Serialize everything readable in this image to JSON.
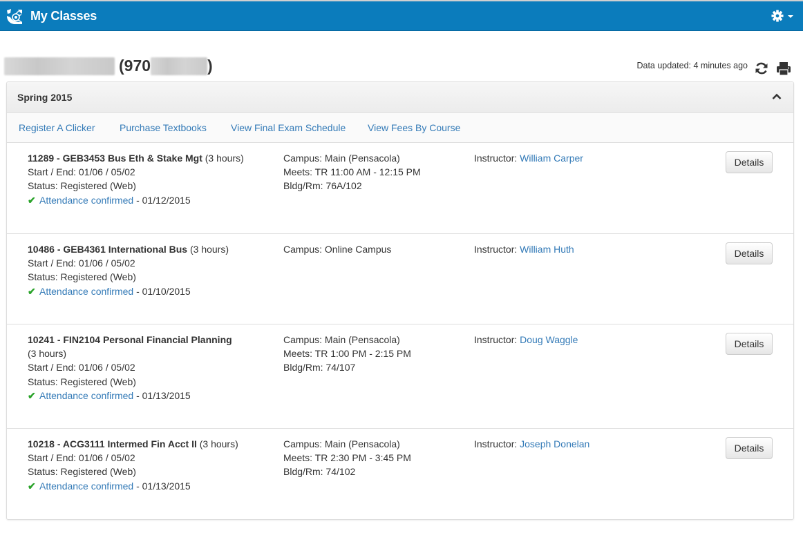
{
  "app": {
    "title": "My Classes",
    "logo_icon": "university-logo-icon",
    "settings_icon": "gear-icon"
  },
  "header": {
    "student_id_prefix": "(970",
    "student_id_suffix": ")",
    "data_updated": "Data updated: 4 minutes ago",
    "refresh_icon": "refresh-icon",
    "print_icon": "print-icon"
  },
  "term": {
    "title": "Spring 2015",
    "collapse_icon": "chevron-up-icon",
    "links": [
      {
        "label": "Register A Clicker"
      },
      {
        "label": "Purchase Textbooks"
      },
      {
        "label": "View Final Exam Schedule"
      },
      {
        "label": "View Fees By Course"
      }
    ]
  },
  "courses": [
    {
      "title": "11289 - GEB3453 Bus Eth & Stake Mgt",
      "hours": "(3 hours)",
      "start_end": "Start / End: 01/06 / 05/02",
      "status": "Status: Registered (Web)",
      "attendance_label": "Attendance confirmed",
      "attendance_date": " - 01/12/2015",
      "campus": "Campus: Main (Pensacola)",
      "meets": "Meets: TR 11:00 AM - 12:15 PM",
      "room": "Bldg/Rm: 76A/102",
      "instructor_label": "Instructor: ",
      "instructor": "William Carper",
      "details_label": "Details"
    },
    {
      "title": "10486 - GEB4361 International Bus",
      "hours": "(3 hours)",
      "start_end": "Start / End: 01/06 / 05/02",
      "status": "Status: Registered (Web)",
      "attendance_label": "Attendance confirmed",
      "attendance_date": " - 01/10/2015",
      "campus": "Campus: Online Campus",
      "meets": "",
      "room": "",
      "instructor_label": "Instructor: ",
      "instructor": "William Huth",
      "details_label": "Details"
    },
    {
      "title": "10241 - FIN2104 Personal Financial Planning",
      "hours": "(3 hours)",
      "start_end": "Start / End: 01/06 / 05/02",
      "status": "Status: Registered (Web)",
      "attendance_label": "Attendance confirmed",
      "attendance_date": " - 01/13/2015",
      "campus": "Campus: Main (Pensacola)",
      "meets": "Meets: TR 1:00 PM - 2:15 PM",
      "room": "Bldg/Rm: 74/107",
      "instructor_label": "Instructor: ",
      "instructor": "Doug Waggle",
      "details_label": "Details"
    },
    {
      "title": "10218 - ACG3111 Intermed Fin Acct II",
      "hours": "(3 hours)",
      "start_end": "Start / End: 01/06 / 05/02",
      "status": "Status: Registered (Web)",
      "attendance_label": "Attendance confirmed",
      "attendance_date": " - 01/13/2015",
      "campus": "Campus: Main (Pensacola)",
      "meets": "Meets: TR 2:30 PM - 3:45 PM",
      "room": "Bldg/Rm: 74/102",
      "instructor_label": "Instructor: ",
      "instructor": "Joseph Donelan",
      "details_label": "Details"
    }
  ],
  "colors": {
    "brand": "#0b7cbc",
    "link": "#337ab7",
    "check": "#2aa32a"
  }
}
